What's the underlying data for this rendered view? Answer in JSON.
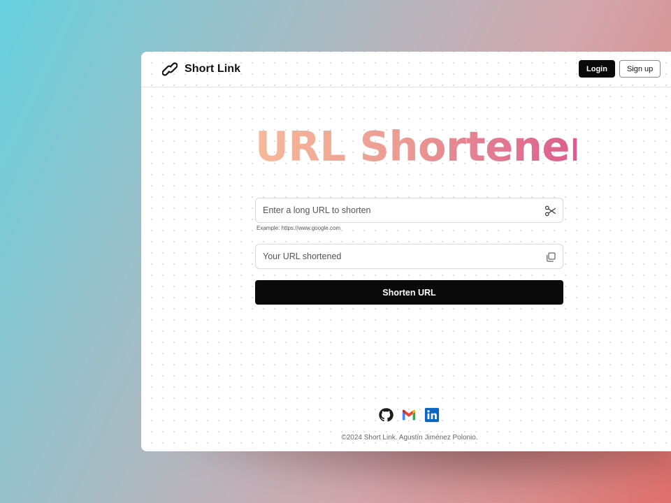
{
  "brand": {
    "name": "Short Link",
    "icon": "link-icon"
  },
  "nav": {
    "login_label": "Login",
    "signup_label": "Sign up"
  },
  "hero": {
    "title": "URL Shortener",
    "gradient_colors": [
      "#f6b999",
      "#dc5e8b"
    ]
  },
  "form": {
    "url_input": {
      "value": "",
      "placeholder": "Enter a long URL to shorten",
      "icon": "scissors-icon"
    },
    "hint": "Example: https://www.google.com",
    "short_output": {
      "value": "",
      "placeholder": "Your URL shortened",
      "icon": "copy-icon"
    },
    "submit_label": "Shorten URL"
  },
  "footer": {
    "socials": [
      {
        "name": "GitHub",
        "icon": "github-icon"
      },
      {
        "name": "Gmail",
        "icon": "gmail-icon"
      },
      {
        "name": "LinkedIn",
        "icon": "linkedin-icon"
      }
    ],
    "copyright": "©2024 Short Link. Agustín Jiménez Polonio."
  },
  "colors": {
    "primary": "#0a0a0a",
    "background_gradient": [
      "#66d1de",
      "#e06f6c"
    ],
    "linkedin": "#0a66c2"
  }
}
